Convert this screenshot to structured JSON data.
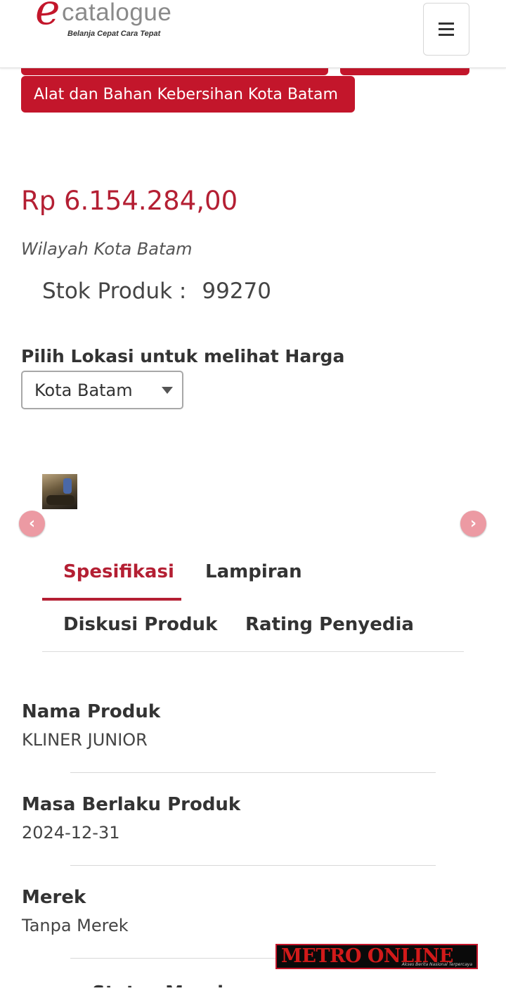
{
  "header": {
    "logo_mark": "e",
    "logo_word": "catalogue",
    "logo_tagline": "Belanja Cepat Cara Tepat",
    "menu_icon": "hamburger-menu-icon"
  },
  "category_chip": "Alat dan Bahan Kebersihan Kota Batam",
  "product": {
    "price": "Rp 6.154.284,00",
    "region": "Wilayah Kota Batam",
    "stock_label": "Stok Produk :",
    "stock_value": "99270"
  },
  "location": {
    "label": "Pilih Lokasi untuk melihat Harga",
    "selected": "Kota Batam"
  },
  "carousel": {
    "prev_icon": "chevron-left-icon",
    "next_icon": "chevron-right-icon",
    "prev_glyph": "‹",
    "next_glyph": "›"
  },
  "tabs": [
    {
      "label": "Spesifikasi",
      "active": true
    },
    {
      "label": "Lampiran",
      "active": false
    },
    {
      "label": "Diskusi Produk",
      "active": false
    },
    {
      "label": "Rating Penyedia",
      "active": false
    }
  ],
  "specs": [
    {
      "label": "Nama Produk",
      "value": "KLINER JUNIOR"
    },
    {
      "label": "Masa Berlaku Produk",
      "value": "2024-12-31"
    },
    {
      "label": "Merek",
      "value": "Tanpa Merek"
    }
  ],
  "partial_spec_label": "Status Merek",
  "watermark": {
    "text": "METRO ONLINE",
    "tagline": "Akses Berita Nasional Terpercaya"
  },
  "colors": {
    "brand_red": "#c3162b",
    "price_red": "#b41f33",
    "arrow_pink": "#ec9aa3"
  }
}
